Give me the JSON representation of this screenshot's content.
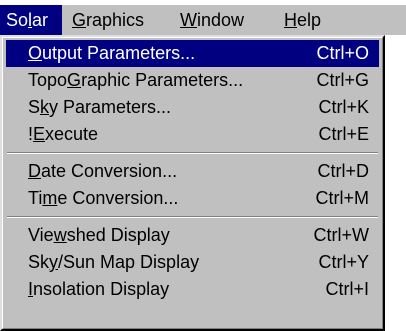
{
  "menubar": {
    "items": [
      {
        "pre": "So",
        "ul": "l",
        "post": "ar"
      },
      {
        "pre": "",
        "ul": "G",
        "post": "raphics"
      },
      {
        "pre": "",
        "ul": "W",
        "post": "indow"
      },
      {
        "pre": "",
        "ul": "H",
        "post": "elp"
      }
    ]
  },
  "menu": {
    "items": [
      {
        "pre": "",
        "ul": "O",
        "post": "utput Parameters...",
        "shortcut": "Ctrl+O"
      },
      {
        "pre": "Topo",
        "ul": "G",
        "post": "raphic Parameters...",
        "shortcut": "Ctrl+G"
      },
      {
        "pre": "S",
        "ul": "k",
        "post": "y Parameters...",
        "shortcut": "Ctrl+K"
      },
      {
        "pre": "!",
        "ul": "E",
        "post": "xecute",
        "shortcut": "Ctrl+E"
      },
      {
        "pre": "",
        "ul": "D",
        "post": "ate Conversion...",
        "shortcut": "Ctrl+D"
      },
      {
        "pre": "Ti",
        "ul": "m",
        "post": "e Conversion...",
        "shortcut": "Ctrl+M"
      },
      {
        "pre": "Vie",
        "ul": "w",
        "post": "shed Display",
        "shortcut": "Ctrl+W"
      },
      {
        "pre": "Sk",
        "ul": "y",
        "post": "/Sun Map Display",
        "shortcut": "Ctrl+Y"
      },
      {
        "pre": "",
        "ul": "I",
        "post": "nsolation Display",
        "shortcut": "Ctrl+I"
      }
    ]
  },
  "colors": {
    "menu_face": "#c0c0c0",
    "highlight": "#000080",
    "highlight_text": "#ffffff"
  }
}
